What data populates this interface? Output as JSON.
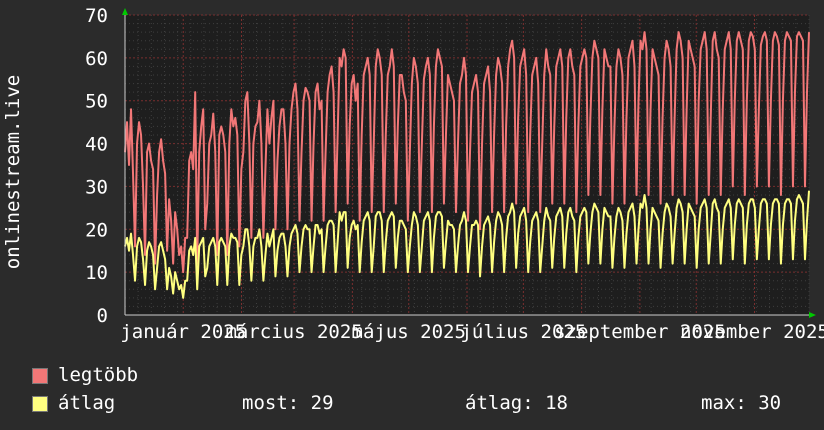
{
  "colors": {
    "background": "#2b2b2b",
    "plot_background": "#1e1e1e",
    "grid_minor": "#3f3f3f",
    "grid_major": "#7a2f2f",
    "axis": "#cccccc",
    "arrow": "#00c800"
  },
  "chart_data": {
    "type": "area",
    "ylabel": "onlinestream.live",
    "ylim": [
      0,
      70
    ],
    "yticks": [
      "0",
      "10",
      "20",
      "30",
      "40",
      "50",
      "60",
      "70"
    ],
    "xtick_labels": [
      "január 2025",
      "március 2025",
      "május 2025",
      "július 2025",
      "szeptember 2025",
      "november 2025"
    ],
    "x_range": [
      "2024-12-01",
      "2025-11-30"
    ],
    "grid": true,
    "series": [
      {
        "name": "legtöbb",
        "color": "#f27777",
        "values": [
          38,
          45,
          35,
          48,
          33,
          16,
          40,
          45,
          42,
          30,
          14,
          38,
          40,
          36,
          34,
          12,
          28,
          38,
          41,
          36,
          33,
          15,
          27,
          22,
          12,
          24,
          20,
          14,
          16,
          10,
          18,
          18,
          36,
          38,
          34,
          52,
          12,
          38,
          44,
          48,
          20,
          26,
          40,
          42,
          47,
          38,
          14,
          42,
          44,
          42,
          38,
          14,
          40,
          48,
          44,
          46,
          42,
          16,
          34,
          38,
          50,
          52,
          40,
          18,
          40,
          44,
          45,
          50,
          40,
          18,
          34,
          48,
          40,
          46,
          50,
          20,
          36,
          44,
          48,
          48,
          40,
          20,
          40,
          48,
          52,
          54,
          48,
          22,
          38,
          50,
          53,
          52,
          50,
          22,
          40,
          52,
          54,
          48,
          50,
          22,
          38,
          52,
          56,
          58,
          52,
          24,
          42,
          60,
          58,
          62,
          60,
          26,
          44,
          54,
          56,
          50,
          54,
          22,
          42,
          56,
          58,
          60,
          56,
          24,
          40,
          58,
          62,
          60,
          56,
          24,
          42,
          56,
          58,
          62,
          58,
          26,
          44,
          56,
          56,
          52,
          50,
          22,
          38,
          54,
          60,
          58,
          54,
          24,
          40,
          55,
          58,
          60,
          56,
          24,
          44,
          58,
          62,
          60,
          58,
          26,
          42,
          56,
          54,
          52,
          50,
          24,
          40,
          54,
          56,
          60,
          56,
          22,
          38,
          52,
          54,
          56,
          52,
          20,
          40,
          54,
          56,
          58,
          52,
          24,
          42,
          56,
          60,
          58,
          54,
          24,
          44,
          58,
          62,
          64,
          60,
          26,
          46,
          58,
          60,
          62,
          56,
          24,
          42,
          56,
          58,
          60,
          54,
          24,
          40,
          56,
          62,
          58,
          56,
          26,
          44,
          58,
          60,
          62,
          58,
          26,
          46,
          60,
          62,
          58,
          56,
          24,
          44,
          58,
          60,
          62,
          60,
          28,
          46,
          60,
          64,
          62,
          60,
          28,
          48,
          62,
          60,
          58,
          58,
          26,
          44,
          58,
          62,
          60,
          56,
          26,
          46,
          60,
          62,
          64,
          58,
          28,
          50,
          64,
          62,
          66,
          62,
          28,
          48,
          62,
          60,
          58,
          56,
          26,
          46,
          60,
          64,
          62,
          58,
          28,
          46,
          62,
          66,
          64,
          60,
          28,
          48,
          64,
          62,
          60,
          58,
          26,
          50,
          62,
          64,
          66,
          62,
          28,
          46,
          64,
          66,
          62,
          60,
          28,
          48,
          62,
          64,
          66,
          62,
          30,
          50,
          64,
          66,
          64,
          62,
          28,
          50,
          64,
          66,
          65,
          62,
          30,
          48,
          63,
          65,
          66,
          64,
          30,
          50,
          64,
          66,
          65,
          63,
          28,
          50,
          64,
          66,
          65,
          64,
          30,
          52,
          65,
          66,
          65,
          64,
          30,
          52,
          66
        ]
      },
      {
        "name": "átlag",
        "color": "#ffff80",
        "values": [
          16,
          18,
          15,
          19,
          14,
          8,
          16,
          18,
          17,
          13,
          7,
          15,
          17,
          16,
          14,
          6,
          11,
          16,
          17,
          15,
          13,
          6,
          11,
          9,
          5,
          10,
          8,
          6,
          7,
          4,
          8,
          8,
          15,
          16,
          14,
          18,
          6,
          16,
          17,
          18,
          9,
          11,
          16,
          17,
          18,
          16,
          7,
          17,
          18,
          17,
          16,
          7,
          16,
          19,
          18,
          18,
          17,
          7,
          14,
          16,
          20,
          20,
          16,
          8,
          16,
          18,
          18,
          20,
          16,
          8,
          14,
          19,
          16,
          18,
          20,
          9,
          15,
          18,
          19,
          19,
          16,
          9,
          16,
          19,
          20,
          21,
          19,
          10,
          16,
          20,
          21,
          20,
          20,
          10,
          16,
          21,
          21,
          19,
          20,
          10,
          16,
          21,
          22,
          22,
          21,
          10,
          17,
          24,
          22,
          24,
          24,
          11,
          18,
          21,
          22,
          20,
          21,
          10,
          17,
          22,
          23,
          24,
          22,
          10,
          16,
          23,
          24,
          24,
          22,
          10,
          17,
          22,
          23,
          24,
          23,
          11,
          18,
          22,
          22,
          21,
          20,
          10,
          16,
          21,
          24,
          23,
          21,
          10,
          16,
          22,
          23,
          24,
          22,
          10,
          18,
          23,
          24,
          24,
          23,
          11,
          17,
          22,
          21,
          21,
          20,
          10,
          16,
          21,
          22,
          24,
          22,
          10,
          16,
          21,
          21,
          22,
          21,
          9,
          16,
          21,
          22,
          23,
          21,
          10,
          17,
          22,
          24,
          23,
          21,
          10,
          18,
          23,
          24,
          26,
          24,
          11,
          19,
          23,
          24,
          25,
          22,
          10,
          17,
          22,
          23,
          24,
          22,
          10,
          16,
          22,
          25,
          23,
          22,
          11,
          18,
          23,
          24,
          25,
          23,
          11,
          19,
          24,
          25,
          23,
          22,
          10,
          18,
          23,
          24,
          25,
          24,
          12,
          19,
          24,
          26,
          25,
          24,
          12,
          20,
          25,
          24,
          23,
          23,
          11,
          18,
          23,
          25,
          24,
          22,
          11,
          19,
          24,
          25,
          26,
          23,
          12,
          20,
          26,
          25,
          28,
          25,
          12,
          20,
          25,
          24,
          23,
          22,
          11,
          19,
          24,
          26,
          25,
          23,
          12,
          19,
          25,
          27,
          26,
          24,
          12,
          20,
          26,
          25,
          24,
          23,
          11,
          20,
          25,
          26,
          27,
          25,
          12,
          19,
          26,
          27,
          25,
          24,
          12,
          20,
          25,
          26,
          27,
          25,
          13,
          21,
          26,
          27,
          26,
          25,
          12,
          21,
          26,
          27,
          27,
          25,
          13,
          20,
          26,
          27,
          27,
          26,
          13,
          21,
          26,
          27,
          27,
          26,
          12,
          21,
          26,
          27,
          27,
          26,
          13,
          22,
          27,
          28,
          27,
          26,
          13,
          22,
          29
        ]
      }
    ]
  },
  "legend": {
    "max_label": "legtöbb",
    "avg_label": "átlag",
    "stat_now": "most: 29",
    "stat_avg": "átlag: 18",
    "stat_max": "max: 30"
  }
}
